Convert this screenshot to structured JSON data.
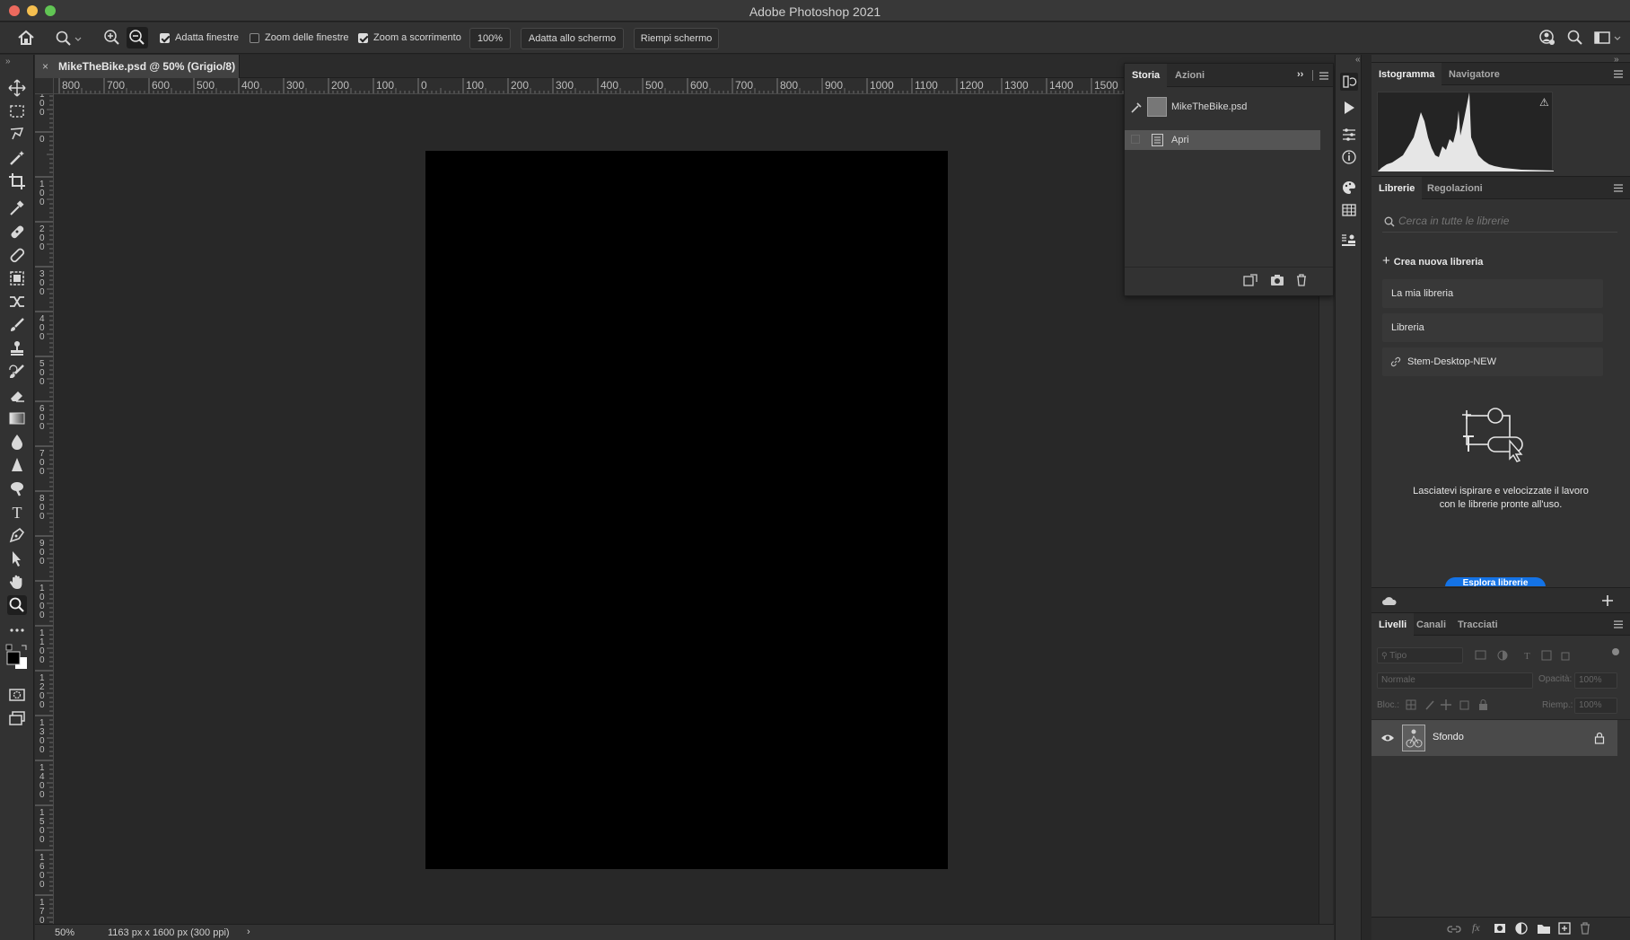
{
  "window": {
    "title": "Adobe Photoshop 2021",
    "traffic_colors": [
      "#ed6a5e",
      "#f5bf4f",
      "#61c554"
    ]
  },
  "options": {
    "checks": [
      {
        "label": "Adatta finestre",
        "checked": true
      },
      {
        "label": "Zoom delle finestre",
        "checked": false
      },
      {
        "label": "Zoom a scorrimento",
        "checked": true
      }
    ],
    "zoom_value": "100%",
    "fit_screen_label": "Adatta allo schermo",
    "fill_screen_label": "Riempi schermo"
  },
  "document": {
    "tab_title": "MikeTheBike.psd @ 50% (Grigio/8)",
    "close_glyph": "×",
    "canvas_color": "#000000"
  },
  "rulers": {
    "horizontal": [
      "800",
      "700",
      "600",
      "500",
      "400",
      "300",
      "200",
      "100",
      "0",
      "100",
      "200",
      "300",
      "400",
      "500",
      "600",
      "700",
      "800",
      "900",
      "1000",
      "1100",
      "1200",
      "1300",
      "1400",
      "1500"
    ],
    "vertical": [
      "100",
      "0",
      "100",
      "200",
      "300",
      "400",
      "500",
      "600",
      "700",
      "800",
      "900",
      "1000",
      "1100",
      "1200",
      "1300",
      "1400",
      "1500",
      "1600",
      "1700"
    ]
  },
  "status": {
    "zoom": "50%",
    "dimensions": "1163 px x 1600 px (300 ppi)",
    "arrow": "›"
  },
  "history_panel": {
    "tabs": [
      "Storia",
      "Azioni"
    ],
    "expand_glyph": "››",
    "snapshot_name": "MikeTheBike.psd",
    "steps": [
      "Apri"
    ]
  },
  "histogram_panel": {
    "tabs": [
      "Istogramma",
      "Navigatore"
    ],
    "warning_glyph": "⚠"
  },
  "libraries_panel": {
    "tabs": [
      "Librerie",
      "Regolazioni"
    ],
    "search_placeholder": "Cerca in tutte le librerie",
    "create_label": "Crea nuova libreria",
    "items": [
      "La mia libreria",
      "Libreria",
      "Stem-Desktop-NEW"
    ],
    "promo_text_1": "Lasciatevi ispirare e velocizzate il lavoro",
    "promo_text_2": "con le librerie pronte all'uso.",
    "explore_button": "Esplora librerie"
  },
  "layers_panel": {
    "tabs": [
      "Livelli",
      "Canali",
      "Tracciati"
    ],
    "filter_placeholder": "Tipo",
    "blend_mode": "Normale",
    "opacity_label": "Opacità:",
    "opacity_value": "100%",
    "lock_label": "Bloc.:",
    "fill_label": "Riemp.:",
    "fill_value": "100%",
    "layers": [
      {
        "name": "Sfondo",
        "locked": true,
        "visible": true
      }
    ],
    "footer_fx": "fx"
  },
  "accent_color": "#1473e6"
}
